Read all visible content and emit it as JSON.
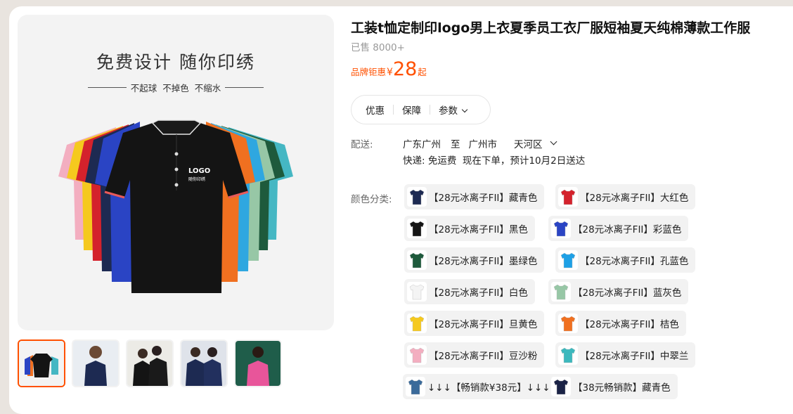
{
  "main_image": {
    "slogan": "免费设计 随你印绣",
    "sub_slogan": "不起球  不掉色  不缩水",
    "logo_text": "LOGO",
    "logo_sub": "随你印绣"
  },
  "product": {
    "title": "工装t恤定制印logo男上衣夏季员工衣厂服短袖夏天纯棉薄款工作服",
    "sold": "已售 8000+",
    "price_prefix": "品牌钜惠",
    "currency": "¥",
    "price": "28",
    "price_suffix": "起"
  },
  "tabs": {
    "discount": "优惠",
    "guarantee": "保障",
    "params": "参数"
  },
  "shipping": {
    "label": "配送:",
    "from": "广东广州",
    "to_word": "至",
    "city": "广州市",
    "district": "天河区",
    "info": "快递: 免运费  现在下单，预计10月2日送达"
  },
  "colors": {
    "label": "颜色分类:",
    "options": [
      {
        "label": "【28元冰离子FII】藏青色",
        "swatch": "#1d2a52"
      },
      {
        "label": "【28元冰离子FII】大红色",
        "swatch": "#d4222c"
      },
      {
        "label": "【28元冰离子FII】黑色",
        "swatch": "#151515"
      },
      {
        "label": "【28元冰离子FII】彩蓝色",
        "swatch": "#2a44c4"
      },
      {
        "label": "【28元冰离子FII】墨绿色",
        "swatch": "#1e5a3c"
      },
      {
        "label": "【28元冰离子FII】孔蓝色",
        "swatch": "#1ea0e6"
      },
      {
        "label": "【28元冰离子FII】白色",
        "swatch": "#f4f4f4"
      },
      {
        "label": "【28元冰离子FII】蓝灰色",
        "swatch": "#97c7a6"
      },
      {
        "label": "【28元冰离子FII】旦黄色",
        "swatch": "#f5c91e"
      },
      {
        "label": "【28元冰离子FII】桔色",
        "swatch": "#f07020"
      },
      {
        "label": "【28元冰离子FII】豆沙粉",
        "swatch": "#f3aec0"
      },
      {
        "label": "【28元冰离子FII】中翠兰",
        "swatch": "#3cb8bd"
      },
      {
        "label": "↓↓↓【畅销款¥38元】↓↓↓",
        "swatch": "#3a6a9a"
      },
      {
        "label": "【38元畅销款】藏青色",
        "swatch": "#1b2346"
      }
    ]
  },
  "colors_theme": {
    "accent": "#ff5000",
    "option_bg": "#f2f2f2"
  }
}
